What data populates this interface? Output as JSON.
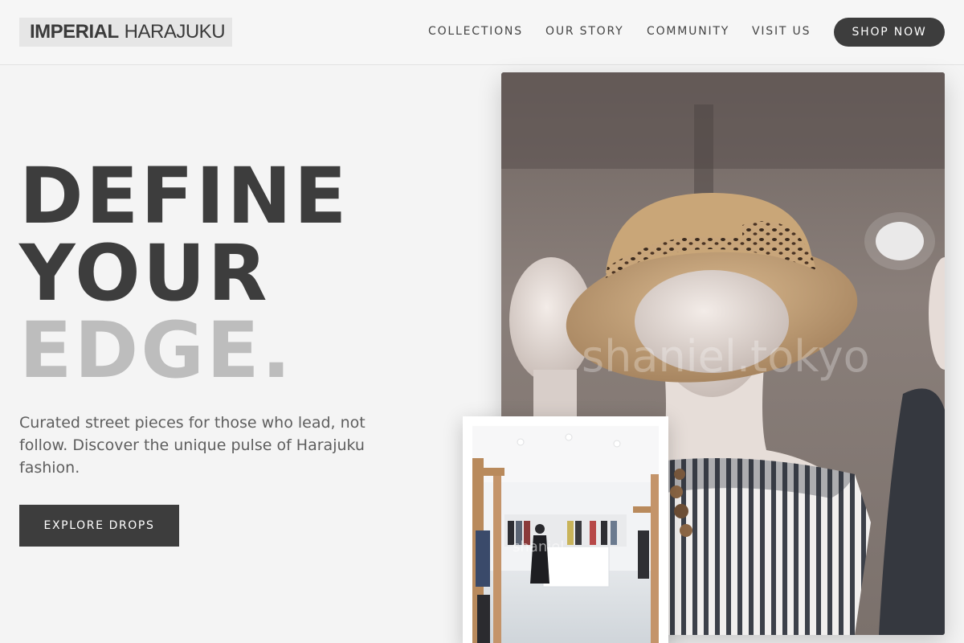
{
  "brand": {
    "name_bold": "IMPERIAL",
    "name_light": "HARAJUKU"
  },
  "nav": {
    "items": [
      "COLLECTIONS",
      "OUR STORY",
      "COMMUNITY",
      "VISIT US"
    ],
    "cta_label": "SHOP NOW"
  },
  "hero": {
    "headline_line1": "DEFINE",
    "headline_line2": "YOUR",
    "headline_line3": "EDGE.",
    "tagline": "Curated street pieces for those who lead, not follow. Discover the unique pulse of Harajuku fashion.",
    "button_label": "EXPLORE DROPS"
  },
  "images": {
    "main_watermark": "shaniel.tokyo",
    "inset_watermark": "shaniel"
  },
  "colors": {
    "accent": "#3d3d3d",
    "muted_headline": "#bdbdbd",
    "background": "#f4f4f4"
  }
}
